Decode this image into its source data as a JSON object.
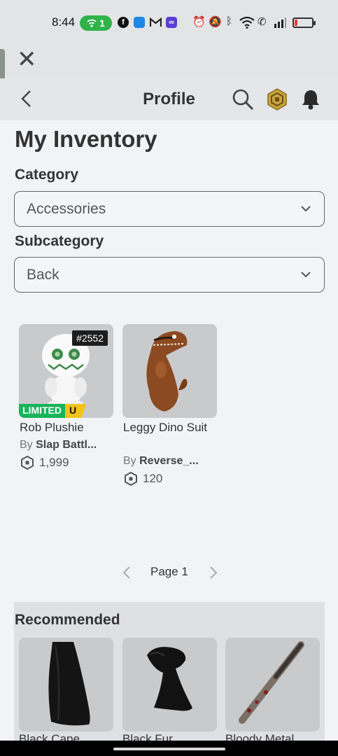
{
  "status_bar": {
    "time": "8:44",
    "hotspot_count": "1",
    "battery_level_percent": 15,
    "icons": [
      "hotspot-icon",
      "facebook-icon",
      "app-icon",
      "gmail-icon",
      "game-icon",
      "alarm-icon",
      "mute-icon",
      "bluetooth-icon",
      "wifi-icon",
      "wifi-calling-icon",
      "signal-icon",
      "battery-icon"
    ]
  },
  "header": {
    "title": "Profile"
  },
  "inventory": {
    "title": "My Inventory",
    "category_label": "Category",
    "category_value": "Accessories",
    "subcategory_label": "Subcategory",
    "subcategory_value": "Back"
  },
  "items": [
    {
      "name": "Rob Plushie",
      "by": "By",
      "creator": "Slap Battl...",
      "price": "1,999",
      "serial": "#2552",
      "limited_label": "LIMITED",
      "limited_u": "U"
    },
    {
      "name": "Leggy Dino Suit",
      "by": "By",
      "creator": "Reverse_...",
      "price": "120"
    }
  ],
  "pagination": {
    "label": "Page 1"
  },
  "recommended": {
    "title": "Recommended",
    "items": [
      {
        "name": "Black Cape"
      },
      {
        "name": "Black Fur"
      },
      {
        "name": "Bloody Metal"
      }
    ]
  },
  "colors": {
    "limited_green": "#18b35a",
    "limited_yellow": "#f2c31b",
    "hotspot_green": "#2fb34a"
  }
}
